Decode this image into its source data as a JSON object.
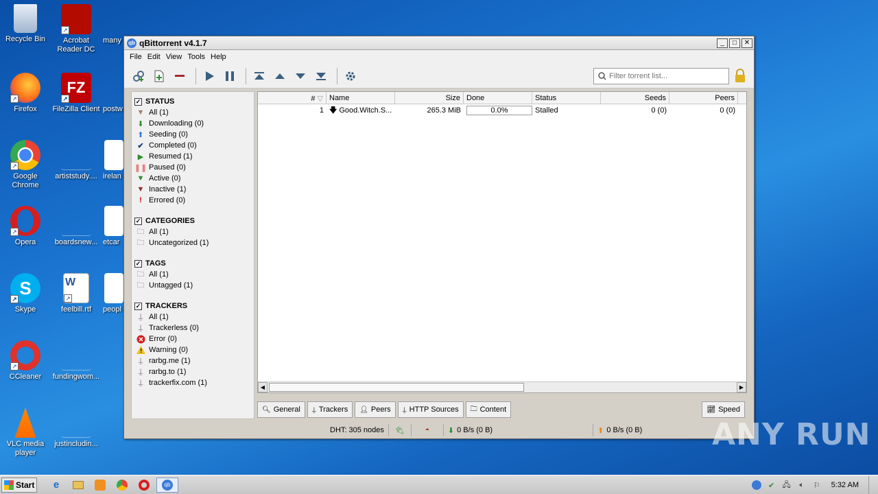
{
  "desktop": {
    "icons": [
      {
        "label": "Recycle Bin"
      },
      {
        "label": "Acrobat Reader DC"
      },
      {
        "label": "many"
      },
      {
        "label": "Firefox"
      },
      {
        "label": "FileZilla Client"
      },
      {
        "label": "postw"
      },
      {
        "label": "Google Chrome"
      },
      {
        "label": "artiststudy...."
      },
      {
        "label": "irelan"
      },
      {
        "label": "Opera"
      },
      {
        "label": "boardsnew..."
      },
      {
        "label": "etcar"
      },
      {
        "label": "Skype"
      },
      {
        "label": "feelbill.rtf"
      },
      {
        "label": "peopl"
      },
      {
        "label": "CCleaner"
      },
      {
        "label": "fundingwom..."
      },
      {
        "label": "VLC media player"
      },
      {
        "label": "justincludin..."
      }
    ]
  },
  "window": {
    "title": "qBittorrent v4.1.7",
    "menu": [
      "File",
      "Edit",
      "View",
      "Tools",
      "Help"
    ],
    "filter_placeholder": "Filter torrent list..."
  },
  "sidebar": {
    "status": {
      "heading": "STATUS",
      "items": [
        "All (1)",
        "Downloading (0)",
        "Seeding (0)",
        "Completed (0)",
        "Resumed (1)",
        "Paused (0)",
        "Active (0)",
        "Inactive (1)",
        "Errored (0)"
      ]
    },
    "categories": {
      "heading": "CATEGORIES",
      "items": [
        "All (1)",
        "Uncategorized (1)"
      ]
    },
    "tags": {
      "heading": "TAGS",
      "items": [
        "All (1)",
        "Untagged (1)"
      ]
    },
    "trackers": {
      "heading": "TRACKERS",
      "items": [
        "All (1)",
        "Trackerless (0)",
        "Error (0)",
        "Warning (0)",
        "rarbg.me (1)",
        "rarbg.to (1)",
        "trackerfix.com (1)"
      ]
    }
  },
  "torrent_list": {
    "columns": [
      "#",
      "Name",
      "Size",
      "Done",
      "Status",
      "Seeds",
      "Peers"
    ],
    "rows": [
      {
        "num": "1",
        "name": "Good.Witch.S...",
        "size": "265.3 MiB",
        "done": "0.0%",
        "status": "Stalled",
        "seeds": "0 (0)",
        "peers": "0 (0)"
      }
    ]
  },
  "tabs": [
    "General",
    "Trackers",
    "Peers",
    "HTTP Sources",
    "Content"
  ],
  "speed_button": "Speed",
  "statusbar": {
    "dht": "DHT: 305 nodes",
    "download": "0 B/s (0 B)",
    "upload": "0 B/s (0 B)"
  },
  "taskbar": {
    "start": "Start",
    "clock": "5:32 AM"
  },
  "watermark": "ANY RUN"
}
